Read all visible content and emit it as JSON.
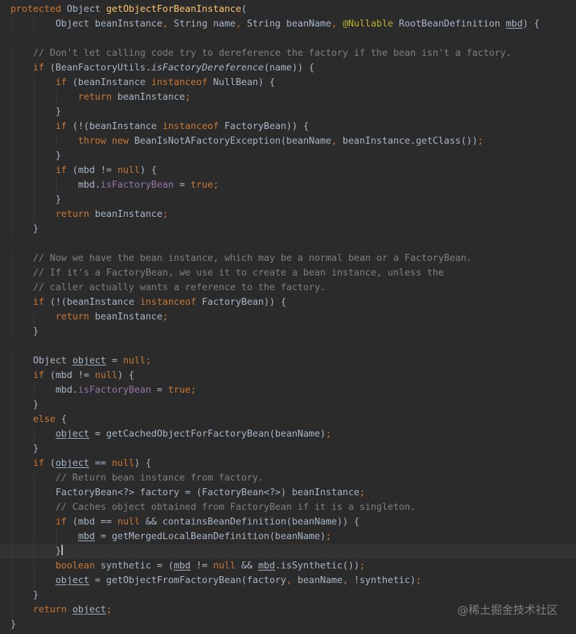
{
  "editor": {
    "caret_line": 37,
    "lines": [
      {
        "indent": 0,
        "tokens": [
          [
            "keyword",
            "protected"
          ],
          [
            "plain",
            " Object "
          ],
          [
            "function",
            "getObjectForBeanInstance"
          ],
          [
            "plain",
            "("
          ]
        ]
      },
      {
        "indent": 2,
        "tokens": [
          [
            "plain",
            "Object beanInstance"
          ],
          [
            "punct",
            ","
          ],
          [
            "plain",
            " String name"
          ],
          [
            "punct",
            ","
          ],
          [
            "plain",
            " String beanName"
          ],
          [
            "punct",
            ","
          ],
          [
            "plain",
            " "
          ],
          [
            "annotation",
            "@Nullable"
          ],
          [
            "plain",
            " RootBeanDefinition "
          ],
          [
            "underline",
            "mbd"
          ],
          [
            "plain",
            ") {"
          ]
        ]
      },
      {
        "indent": 0,
        "tokens": []
      },
      {
        "indent": 1,
        "tokens": [
          [
            "comment",
            "// Don't let calling code try to dereference the factory if the bean isn't a factory."
          ]
        ]
      },
      {
        "indent": 1,
        "tokens": [
          [
            "keyword",
            "if"
          ],
          [
            "plain",
            " (BeanFactoryUtils."
          ],
          [
            "italic",
            "isFactoryDereference"
          ],
          [
            "plain",
            "(name)) {"
          ]
        ]
      },
      {
        "indent": 2,
        "tokens": [
          [
            "keyword",
            "if"
          ],
          [
            "plain",
            " (beanInstance "
          ],
          [
            "keyword",
            "instanceof"
          ],
          [
            "plain",
            " NullBean) {"
          ]
        ]
      },
      {
        "indent": 3,
        "tokens": [
          [
            "keyword",
            "return"
          ],
          [
            "plain",
            " beanInstance"
          ],
          [
            "punct",
            ";"
          ]
        ]
      },
      {
        "indent": 2,
        "tokens": [
          [
            "plain",
            "}"
          ]
        ]
      },
      {
        "indent": 2,
        "tokens": [
          [
            "keyword",
            "if"
          ],
          [
            "plain",
            " (!(beanInstance "
          ],
          [
            "keyword",
            "instanceof"
          ],
          [
            "plain",
            " FactoryBean)) {"
          ]
        ]
      },
      {
        "indent": 3,
        "tokens": [
          [
            "keyword",
            "throw new"
          ],
          [
            "plain",
            " BeanIsNotAFactoryException(beanName"
          ],
          [
            "punct",
            ","
          ],
          [
            "plain",
            " beanInstance.getClass())"
          ],
          [
            "punct",
            ";"
          ]
        ]
      },
      {
        "indent": 2,
        "tokens": [
          [
            "plain",
            "}"
          ]
        ]
      },
      {
        "indent": 2,
        "tokens": [
          [
            "keyword",
            "if"
          ],
          [
            "plain",
            " (mbd != "
          ],
          [
            "keyword",
            "null"
          ],
          [
            "plain",
            ") {"
          ]
        ]
      },
      {
        "indent": 3,
        "tokens": [
          [
            "plain",
            "mbd."
          ],
          [
            "field",
            "isFactoryBean"
          ],
          [
            "plain",
            " = "
          ],
          [
            "keyword",
            "true;"
          ]
        ]
      },
      {
        "indent": 2,
        "tokens": [
          [
            "plain",
            "}"
          ]
        ]
      },
      {
        "indent": 2,
        "tokens": [
          [
            "keyword",
            "return"
          ],
          [
            "plain",
            " beanInstance"
          ],
          [
            "punct",
            ";"
          ]
        ]
      },
      {
        "indent": 1,
        "tokens": [
          [
            "plain",
            "}"
          ]
        ]
      },
      {
        "indent": 0,
        "tokens": []
      },
      {
        "indent": 1,
        "tokens": [
          [
            "comment",
            "// Now we have the bean instance, which may be a normal bean or a FactoryBean."
          ]
        ]
      },
      {
        "indent": 1,
        "tokens": [
          [
            "comment",
            "// If it's a FactoryBean, we use it to create a bean instance, unless the"
          ]
        ]
      },
      {
        "indent": 1,
        "tokens": [
          [
            "comment",
            "// caller actually wants a reference to the factory."
          ]
        ]
      },
      {
        "indent": 1,
        "tokens": [
          [
            "keyword",
            "if"
          ],
          [
            "plain",
            " (!(beanInstance "
          ],
          [
            "keyword",
            "instanceof"
          ],
          [
            "plain",
            " FactoryBean)) {"
          ]
        ]
      },
      {
        "indent": 2,
        "tokens": [
          [
            "keyword",
            "return"
          ],
          [
            "plain",
            " beanInstance"
          ],
          [
            "punct",
            ";"
          ]
        ]
      },
      {
        "indent": 1,
        "tokens": [
          [
            "plain",
            "}"
          ]
        ]
      },
      {
        "indent": 0,
        "tokens": []
      },
      {
        "indent": 1,
        "tokens": [
          [
            "plain",
            "Object "
          ],
          [
            "underline",
            "object"
          ],
          [
            "plain",
            " = "
          ],
          [
            "keyword",
            "null;"
          ]
        ]
      },
      {
        "indent": 1,
        "tokens": [
          [
            "keyword",
            "if"
          ],
          [
            "plain",
            " (mbd != "
          ],
          [
            "keyword",
            "null"
          ],
          [
            "plain",
            ") {"
          ]
        ]
      },
      {
        "indent": 2,
        "tokens": [
          [
            "plain",
            "mbd."
          ],
          [
            "field",
            "isFactoryBean"
          ],
          [
            "plain",
            " = "
          ],
          [
            "keyword",
            "true;"
          ]
        ]
      },
      {
        "indent": 1,
        "tokens": [
          [
            "plain",
            "}"
          ]
        ]
      },
      {
        "indent": 1,
        "tokens": [
          [
            "keyword",
            "else"
          ],
          [
            "plain",
            " {"
          ]
        ]
      },
      {
        "indent": 2,
        "tokens": [
          [
            "underline",
            "object"
          ],
          [
            "plain",
            " = getCachedObjectForFactoryBean(beanName)"
          ],
          [
            "punct",
            ";"
          ]
        ]
      },
      {
        "indent": 1,
        "tokens": [
          [
            "plain",
            "}"
          ]
        ]
      },
      {
        "indent": 1,
        "tokens": [
          [
            "keyword",
            "if"
          ],
          [
            "plain",
            " ("
          ],
          [
            "underline",
            "object"
          ],
          [
            "plain",
            " == "
          ],
          [
            "keyword",
            "null"
          ],
          [
            "plain",
            ") {"
          ]
        ]
      },
      {
        "indent": 2,
        "tokens": [
          [
            "comment",
            "// Return bean instance from factory."
          ]
        ]
      },
      {
        "indent": 2,
        "tokens": [
          [
            "plain",
            "FactoryBean<?> factory = (FactoryBean<?>) beanInstance"
          ],
          [
            "punct",
            ";"
          ]
        ]
      },
      {
        "indent": 2,
        "tokens": [
          [
            "comment",
            "// Caches object obtained from FactoryBean if it is a singleton."
          ]
        ]
      },
      {
        "indent": 2,
        "tokens": [
          [
            "keyword",
            "if"
          ],
          [
            "plain",
            " (mbd == "
          ],
          [
            "keyword",
            "null"
          ],
          [
            "plain",
            " && containsBeanDefinition(beanName)) {"
          ]
        ]
      },
      {
        "indent": 3,
        "tokens": [
          [
            "underline",
            "mbd"
          ],
          [
            "plain",
            " = getMergedLocalBeanDefinition(beanName)"
          ],
          [
            "punct",
            ";"
          ]
        ]
      },
      {
        "indent": 2,
        "tokens": [
          [
            "plain",
            "}"
          ]
        ]
      },
      {
        "indent": 2,
        "tokens": [
          [
            "keyword",
            "boolean"
          ],
          [
            "plain",
            " synthetic = ("
          ],
          [
            "underline",
            "mbd"
          ],
          [
            "plain",
            " != "
          ],
          [
            "keyword",
            "null"
          ],
          [
            "plain",
            " && "
          ],
          [
            "underline",
            "mbd"
          ],
          [
            "plain",
            ".isSynthetic())"
          ],
          [
            "punct",
            ";"
          ]
        ]
      },
      {
        "indent": 2,
        "tokens": [
          [
            "underline",
            "object"
          ],
          [
            "plain",
            " = getObjectFromFactoryBean(factory"
          ],
          [
            "punct",
            ","
          ],
          [
            "plain",
            " beanName"
          ],
          [
            "punct",
            ","
          ],
          [
            "plain",
            " !synthetic)"
          ],
          [
            "punct",
            ";"
          ]
        ]
      },
      {
        "indent": 1,
        "tokens": [
          [
            "plain",
            "}"
          ]
        ]
      },
      {
        "indent": 1,
        "tokens": [
          [
            "keyword",
            "return"
          ],
          [
            "plain",
            " "
          ],
          [
            "underline",
            "object"
          ],
          [
            "punct",
            ";"
          ]
        ]
      },
      {
        "indent": 0,
        "tokens": [
          [
            "plain",
            "}"
          ]
        ]
      }
    ]
  },
  "watermark": "@稀土掘金技术社区"
}
